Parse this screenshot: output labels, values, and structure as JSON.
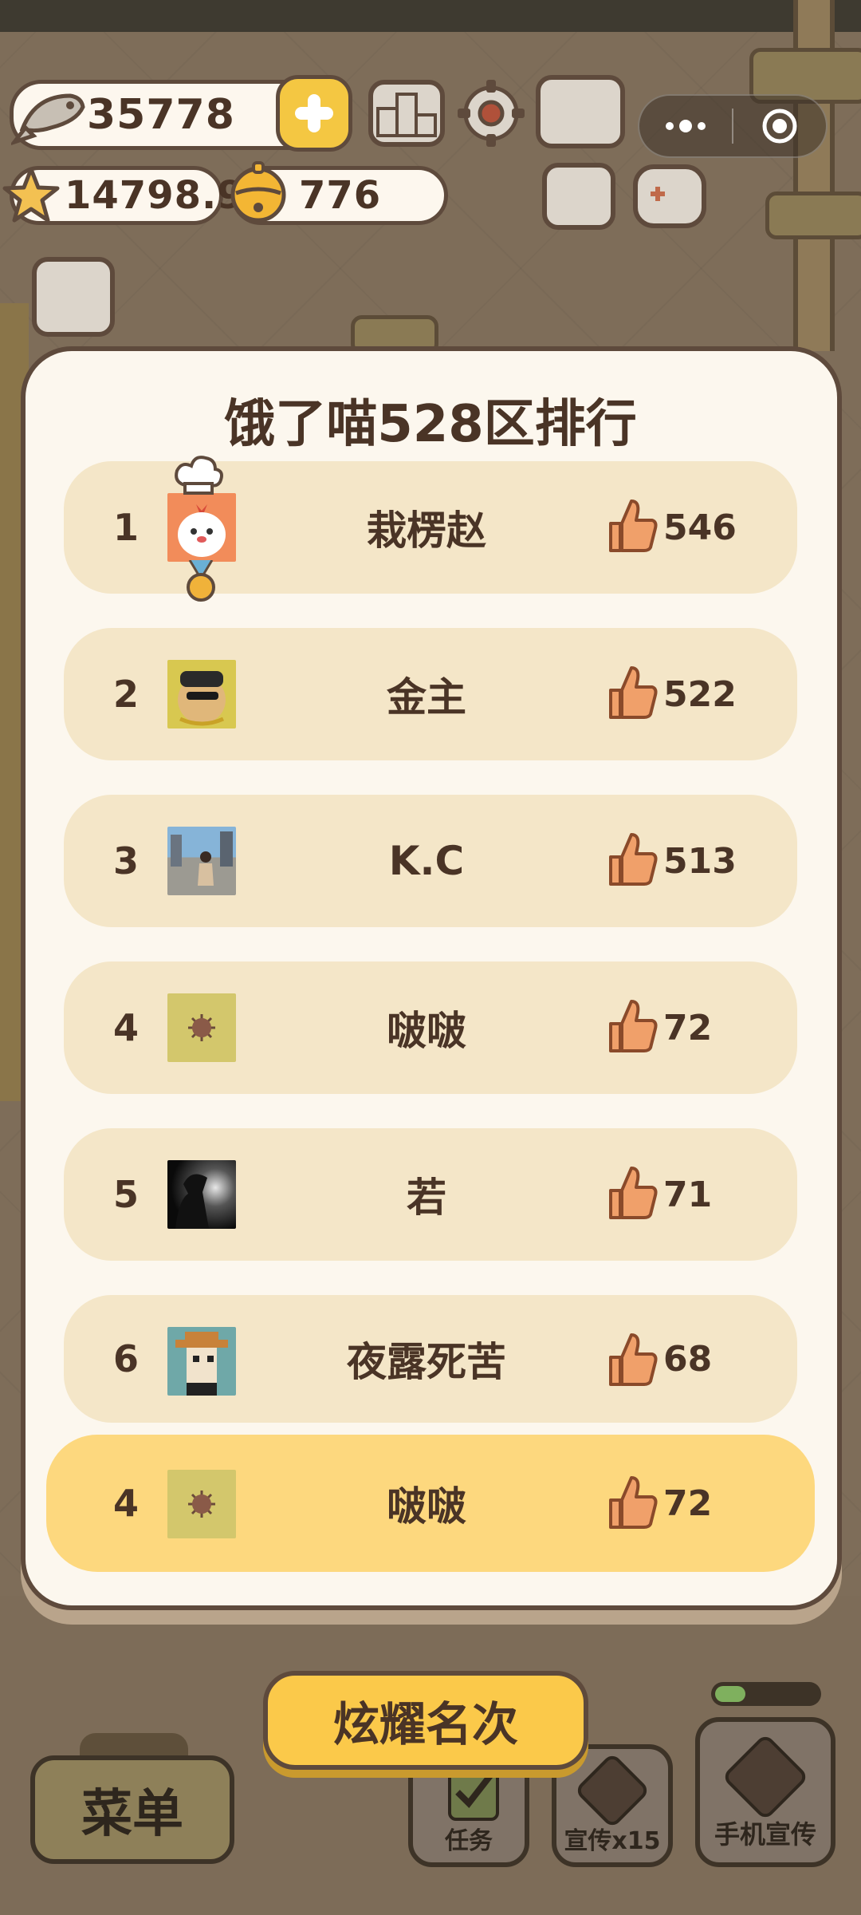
{
  "currency": {
    "fish": "35778",
    "stars": "14798.9",
    "bells": "776"
  },
  "icons": {
    "fish": "fish-icon",
    "star": "star-icon",
    "bell": "bell-icon",
    "plus": "plus-icon",
    "podium": "podium-icon",
    "settings": "gear-icon",
    "book": "paw-book-icon",
    "news": "newspaper-icon",
    "gamepad": "gamepad-icon",
    "shop": "shop-icon",
    "more": "more-dots-icon",
    "close": "target-close-icon",
    "like": "thumbs-up-icon"
  },
  "ranking": {
    "title": "饿了喵528区排行",
    "rows": [
      {
        "rank": "1",
        "name": "栽楞赵",
        "likes": "546"
      },
      {
        "rank": "2",
        "name": "金主",
        "likes": "522"
      },
      {
        "rank": "3",
        "name": "K.C",
        "likes": "513"
      },
      {
        "rank": "4",
        "name": "啵啵",
        "likes": "72"
      },
      {
        "rank": "5",
        "name": "若",
        "likes": "71"
      },
      {
        "rank": "6",
        "name": "夜露死苦",
        "likes": "68"
      }
    ],
    "me": {
      "rank": "4",
      "name": "啵啵",
      "likes": "72"
    }
  },
  "bottom": {
    "flaunt_label": "炫耀名次",
    "menu_label": "菜单",
    "tasks_label": "任务",
    "promote_label": "宣传x15",
    "phone_promote_label": "手机宣传",
    "promote_progress": 0.3
  },
  "colors": {
    "row_bg": "#f4e6c8",
    "my_row_bg": "#fdd87e",
    "button_yellow": "#fbc94a",
    "outline": "#5e4a3c"
  }
}
